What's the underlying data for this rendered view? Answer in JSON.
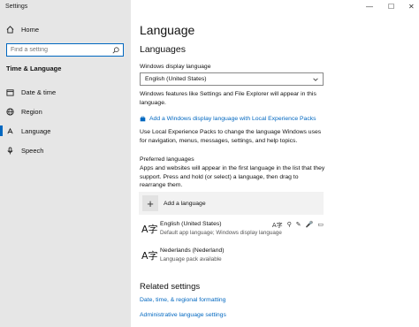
{
  "window": {
    "title": "Settings"
  },
  "sidebar": {
    "home_label": "Home",
    "search_placeholder": "Find a setting",
    "section_title": "Time & Language",
    "items": [
      {
        "label": "Date & time",
        "icon": "calendar-icon"
      },
      {
        "label": "Region",
        "icon": "globe-icon"
      },
      {
        "label": "Language",
        "icon": "language-icon",
        "active": true
      },
      {
        "label": "Speech",
        "icon": "microphone-icon"
      }
    ]
  },
  "main": {
    "title": "Language",
    "languages_heading": "Languages",
    "display_language_label": "Windows display language",
    "display_language_value": "English (United States)",
    "display_language_note": "Windows features like Settings and File Explorer will appear in this language.",
    "add_display_link": "Add a Windows display language with Local Experience Packs",
    "lxp_desc": "Use Local Experience Packs to change the language Windows uses for navigation, menus, messages, settings, and help topics.",
    "preferred_heading": "Preferred languages",
    "preferred_desc": "Apps and websites will appear in the first language in the list that they support. Press and hold (or select) a language, then drag to rearrange them.",
    "add_language_label": "Add a language",
    "languages": [
      {
        "name": "English (United States)",
        "detail": "Default app language; Windows display language",
        "feature_icons": [
          "A字",
          "⚲",
          "✎",
          "🎤",
          "▭"
        ]
      },
      {
        "name": "Nederlands (Nederland)",
        "detail": "Language pack available",
        "feature_icons": []
      }
    ],
    "related_heading": "Related settings",
    "related_links": [
      "Date, time, & regional formatting",
      "Administrative language settings"
    ]
  },
  "window_controls": {
    "minimize": "—",
    "maximize": "☐",
    "close": "✕"
  }
}
